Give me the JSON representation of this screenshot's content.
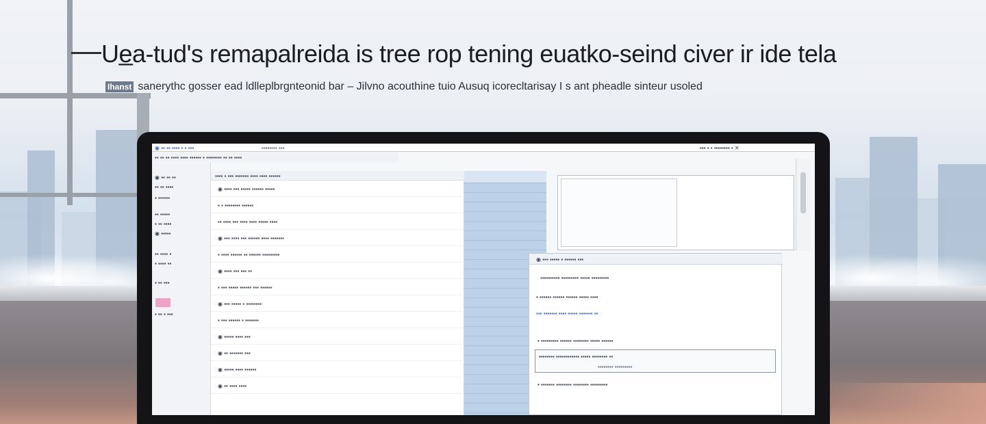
{
  "page": {
    "headline": "Ue̲a-tud's remapalreida is tree rop tening euatko-seind civer ir ide tela",
    "subline_tag": "Ihanst",
    "subline": "sanerythc gosser ead ldlleplbrgnteonid bar – Jilvno acouthine tuio Ausuq icorecltarisay I s ant pheadle sinteur usoled"
  },
  "app": {
    "titlebar_left": "◉ ▪▪ ▪▪ ▪▪▪▪ ▪ ▪ ▪▪▪",
    "titlebar_mid": "▪▪▪▪▪▪▪▪ ▪▪▪",
    "titlebar_right": "▪▪▪ ▪ ▪ ▪▪▪▪▪▪▪▪ ▪ ✕",
    "toolbar": "▪▪ ▪▪ ▪▪ ▪▪▪▪ ▪▪▪▪ ▪▪▪▪▪▪ ▪ ▪▪▪▪▪▪▪▪ ▪▪ ▪▪ ▪▪▪▪",
    "rail_items": [
      "◉ ▪▪ ▪▪ ▪▪",
      "▪▪ ▪▪ ▪▪▪▪",
      "▪ ▪▪▪▪▪▪",
      "▪▪ ▪▪▪▪▪",
      "▪ ▪▪ ▪▪▪▪",
      "◉ ▪▪▪▪▪",
      "▪▪ ▪▪▪▪ ▪",
      "▪ ▪▪▪▪ ▪▪",
      "▪ ▪▪ ▪▪▪",
      "▪ ▪▪ ▪ ▪▪▪"
    ],
    "list_head": "▪▪▪▪ ▪ ▪▪▪ ▪▪▪▪▪▪▪ ▪▪▪▪ ▪▪▪▪ ▪▪▪▪▪▪",
    "list_rows": [
      "◉ ▪▪▪▪ ▪▪▪ ▪▪▪▪▪ ▪▪▪▪▪▪ ▪▪▪▪▪",
      "▪ ▪ ▪▪▪▪▪▪▪▪ ▪▪▪▪▪▪",
      "▪▪ ▪▪▪▪ ▪▪▪ ▪▪▪▪ ▪▪▪▪ ▪▪▪▪▪ ▪▪▪▪",
      "◉ ▪▪▪ ▪▪▪▪ ▪▪▪ ▪▪▪▪▪▪ ▪▪▪▪ ▪▪▪▪▪▪▪",
      "▪ ▪▪▪▪ ▪▪▪▪▪▪ ▪▪ ▪▪▪▪▪▪ ▪▪▪▪▪▪▪▪▪",
      "◉ ▪▪▪▪ ▪▪▪ ▪▪▪ ▪▪",
      "▪ ▪▪▪ ▪▪▪▪▪ ▪▪▪▪▪▪ ▪▪▪ ▪▪▪▪▪▪",
      "◉ ▪▪▪ ▪▪▪▪▪ ▪ ▪▪▪▪▪▪▪▪",
      "▪ ▪▪▪ ▪▪▪▪▪▪ ▪ ▪▪▪▪▪▪▪",
      "◉ ▪▪▪▪▪ ▪▪▪▪ ▪▪▪",
      "◉ ▪▪ ▪▪▪▪▪▪▪ ▪▪▪",
      "◉ ▪▪▪▪▪ ▪▪▪▪ ▪▪▪▪▪▪",
      "◉ ▪▪ ▪▪▪▪ ▪▪▪▪"
    ],
    "detail_bar": "◉ ▪▪▪ ▪▪▪▪▪ ▪ ▪▪▪▪▪▪ ▪▪▪",
    "detail_lines": [
      "▪▪▪▪▪▪▪▪▪▪ ▪▪▪▪▪▪▪▪▪ ▪▪▪▪▪ ▪▪▪▪▪▪▪▪▪",
      "▪ ▪▪▪▪▪▪ ▪▪▪▪▪▪ ▪▪▪▪▪▪ ▪▪▪▪▪ ▪▪▪▪",
      "▪▪▪ ▪▪▪▪▪▪▪ ▪▪▪▪ ▪▪▪▪▪ ▪▪▪▪▪▪▪ ▪▪",
      "▪ ▪▪▪▪▪▪▪▪▪ ▪▪▪▪▪▪ ▪▪▪▪▪▪▪▪ ▪▪▪▪▪ ▪▪▪▪▪▪",
      "▪▪▪▪▪▪▪▪ ▪▪▪▪▪▪▪▪▪▪▪▪ ▪▪▪▪▪ ▪▪▪▪▪▪▪▪ ▪▪",
      "▪▪▪▪▪▪▪▪ ▪▪▪▪▪▪▪▪▪",
      "▪ ▪▪▪▪▪▪▪ ▪▪▪▪▪▪▪▪ ▪▪▪▪▪▪▪▪ ▪▪▪▪▪▪▪▪▪"
    ]
  },
  "colors": {
    "accent": "#3f69b6",
    "pink_badge": "#eca4c6",
    "blue_column": "#bcd2e8"
  }
}
